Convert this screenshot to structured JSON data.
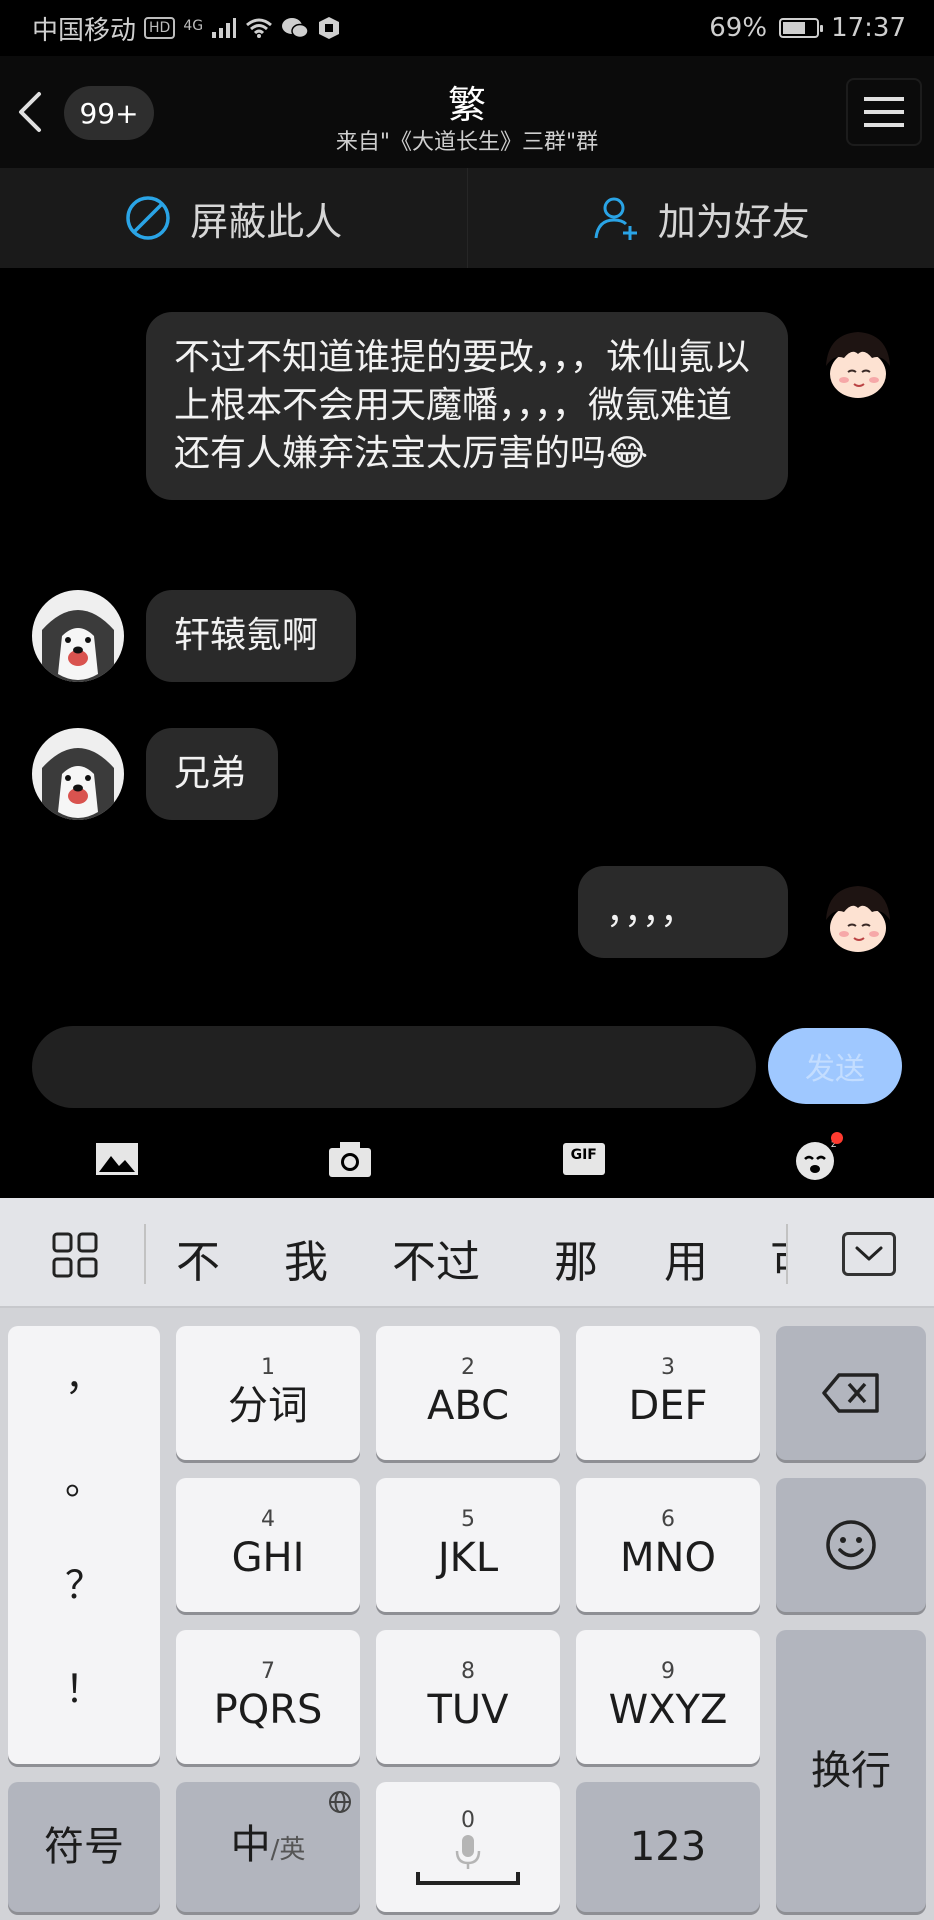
{
  "status_bar": {
    "carrier": "中国移动",
    "hd_badge": "HD",
    "network": "4G",
    "battery_percent": "69%",
    "battery_level": 0.69,
    "time": "17:37"
  },
  "header": {
    "back_icon": "chevron-left-icon",
    "unread_count": "99+",
    "title": "繁",
    "subtitle": "来自\"《大道长生》三群\"群",
    "menu_icon": "hamburger-menu-icon"
  },
  "actions": {
    "block_label": "屏蔽此人",
    "add_friend_label": "加为好友"
  },
  "messages": [
    {
      "side": "right",
      "text": "不过不知道谁提的要改，，，诛仙氪以上根本不会用天魔幡，，，，微氪难道还有人嫌弃法宝太厉害的吗😂"
    },
    {
      "side": "left",
      "text": "轩辕氪啊"
    },
    {
      "side": "left",
      "text": "兄弟"
    },
    {
      "side": "right",
      "text": "，，，，"
    }
  ],
  "composer": {
    "input_value": "",
    "send_label": "发送",
    "tools": [
      "image-icon",
      "camera-icon",
      "gif-icon",
      "sticker-icon"
    ],
    "gif_label": "GIF"
  },
  "keyboard": {
    "candidates": [
      "不",
      "我",
      "不过",
      "那",
      "用",
      "可"
    ],
    "punctuation": [
      "，",
      "。",
      "？",
      "！"
    ],
    "keys": [
      {
        "num": "1",
        "label": "分词"
      },
      {
        "num": "2",
        "label": "ABC"
      },
      {
        "num": "3",
        "label": "DEF"
      },
      {
        "num": "4",
        "label": "GHI"
      },
      {
        "num": "5",
        "label": "JKL"
      },
      {
        "num": "6",
        "label": "MNO"
      },
      {
        "num": "7",
        "label": "PQRS"
      },
      {
        "num": "8",
        "label": "TUV"
      },
      {
        "num": "9",
        "label": "WXYZ"
      }
    ],
    "symbol_label": "符号",
    "lang_main": "中",
    "lang_alt": "/英",
    "space_num": "0",
    "num_label": "123",
    "enter_label": "换行"
  },
  "colors": {
    "send_button": "#9fc8ff",
    "action_icon": "#2aa4e6",
    "notification_dot": "#ff3b30"
  }
}
